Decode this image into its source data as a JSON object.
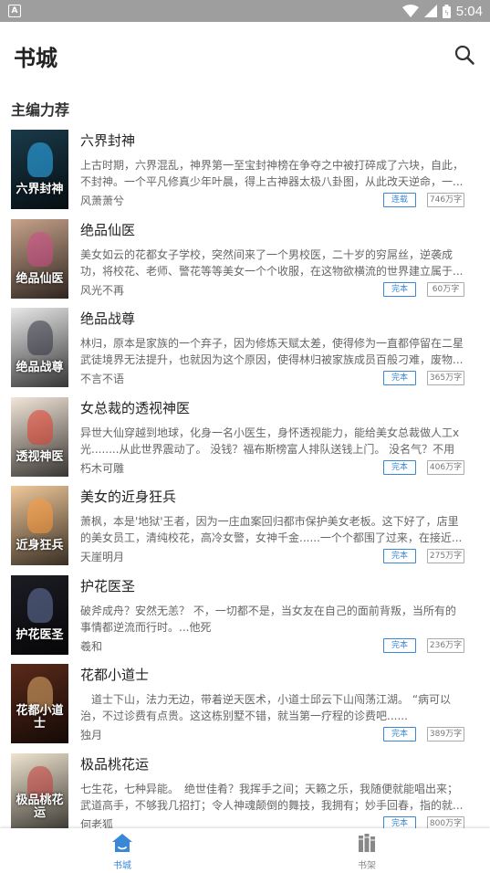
{
  "status_bar": {
    "time": "5:04",
    "app_icon": "A"
  },
  "header": {
    "title": "书城"
  },
  "section": {
    "title": "主编力荐"
  },
  "books": [
    {
      "title": "六界封神",
      "desc": "上古时期，六界混乱，神界第一至宝封神榜在争夺之中被打碎成了六块，自此，不封神。一个平凡修真少年叶晨，得上古神器太极八卦图，从此改天逆命，一...",
      "author": "风萧萧兮",
      "status": "连载",
      "words": "746万字",
      "cover_text": "六界封神",
      "cover_bg": "#1a3a4a",
      "cover_glow": "#2fb8ff"
    },
    {
      "title": "绝品仙医",
      "desc": "美女如云的花都女子学校，突然间来了一个男校医，二十岁的穷屌丝，逆袭成功，将校花、老师、警花等等美女一个个收服，在这物欲横流的世界建立属于...",
      "author": "风光不再",
      "status": "完本",
      "words": "60万字",
      "cover_text": "绝品仙医",
      "cover_bg": "#c7a28a",
      "cover_glow": "#d14a8a"
    },
    {
      "title": "绝品战尊",
      "desc": "林归，原本是家族的一个弃子，因为修炼天赋太差，使得修为一直都停留在二星武徒境界无法提升，也就因为这个原因，使得林归被家族成员百般刁难，废物...",
      "author": "不言不语",
      "status": "完本",
      "words": "365万字",
      "cover_text": "绝品战尊",
      "cover_bg": "#e8e8e8",
      "cover_glow": "#334"
    },
    {
      "title": "女总裁的透视神医",
      "desc": "异世大仙穿越到地球，化身一名小医生，身怀透视能力，能给美女总裁做人工x光........从此世界震动了。 没钱？福布斯榜富人排队送钱上门。 没名气？不用我...",
      "author": "朽木可雕",
      "status": "完本",
      "words": "406万字",
      "cover_text": "透视神医",
      "cover_bg": "#f2e6d8",
      "cover_glow": "#e23c2c"
    },
    {
      "title": "美女的近身狂兵",
      "desc": "萧枫，本是'地狱'王者，因为一庄血案回归都市保护美女老板。这下好了，店里的美女员工，清纯校花，高冷女警，女神千金......一个个都围了过来，在接近...",
      "author": "天崖明月",
      "status": "完本",
      "words": "275万字",
      "cover_text": "近身狂兵",
      "cover_bg": "#f0c89a",
      "cover_glow": "#ff9a3c"
    },
    {
      "title": "护花医圣",
      "desc": "破斧成舟？安然无恙？ 不，一切都不是，当女友在自己的面前背叛，当所有的事情都逆流而行时。...他死",
      "author": "羲和",
      "status": "完本",
      "words": "236万字",
      "cover_text": "护花医圣",
      "cover_bg": "#1c1c24",
      "cover_glow": "#6a7aa8"
    },
    {
      "title": "花都小道士",
      "desc": "　道士下山，法力无边，带着逆天医术，小道士邱云下山闯荡江湖。 “病可以治，不过诊费有点贵。这这栋别墅不错，就当第一疗程的诊费吧......",
      "author": "独月",
      "status": "完本",
      "words": "389万字",
      "cover_text": "花都小道士",
      "cover_bg": "#5a2a1a",
      "cover_glow": "#e8b070"
    },
    {
      "title": "极品桃花运",
      "desc": "七生花，七种异能。　绝世佳肴？我挥手之间；天籁之乐，我随便就能唱出来；武道高手，不够我几招打；令人神魂颠倒的舞技，我拥有；妙手回春，指的就...",
      "author": "何老狐",
      "status": "完本",
      "words": "800万字",
      "cover_text": "极品桃花运",
      "cover_bg": "#efe4cf",
      "cover_glow": "#c23a3a"
    }
  ],
  "nav": {
    "items": [
      {
        "label": "书城"
      },
      {
        "label": "书架"
      }
    ],
    "active_color": "#3a87d6",
    "inactive_color": "#888888"
  }
}
